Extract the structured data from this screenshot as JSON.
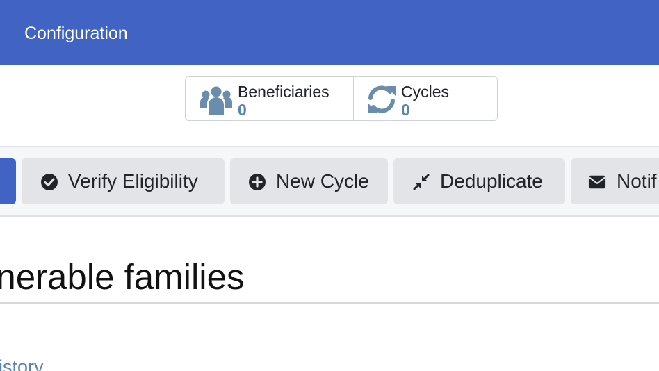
{
  "topbar": {
    "menu_label": "Configuration",
    "background": "#4063c4"
  },
  "smart_buttons": [
    {
      "label": "Beneficiaries",
      "count": "0",
      "icon": "users-icon"
    },
    {
      "label": "Cycles",
      "count": "0",
      "icon": "refresh-icon"
    }
  ],
  "actions": {
    "verify_label": "Verify Eligibility",
    "new_cycle_label": "New Cycle",
    "deduplicate_label": "Deduplicate",
    "notify_label": "Notif"
  },
  "record": {
    "title": "lnerable families"
  },
  "tabs": {
    "partial_label": "listory"
  },
  "colors": {
    "accent": "#4063c4",
    "count": "#5a84b0",
    "button_bg": "#e2e4e7"
  }
}
